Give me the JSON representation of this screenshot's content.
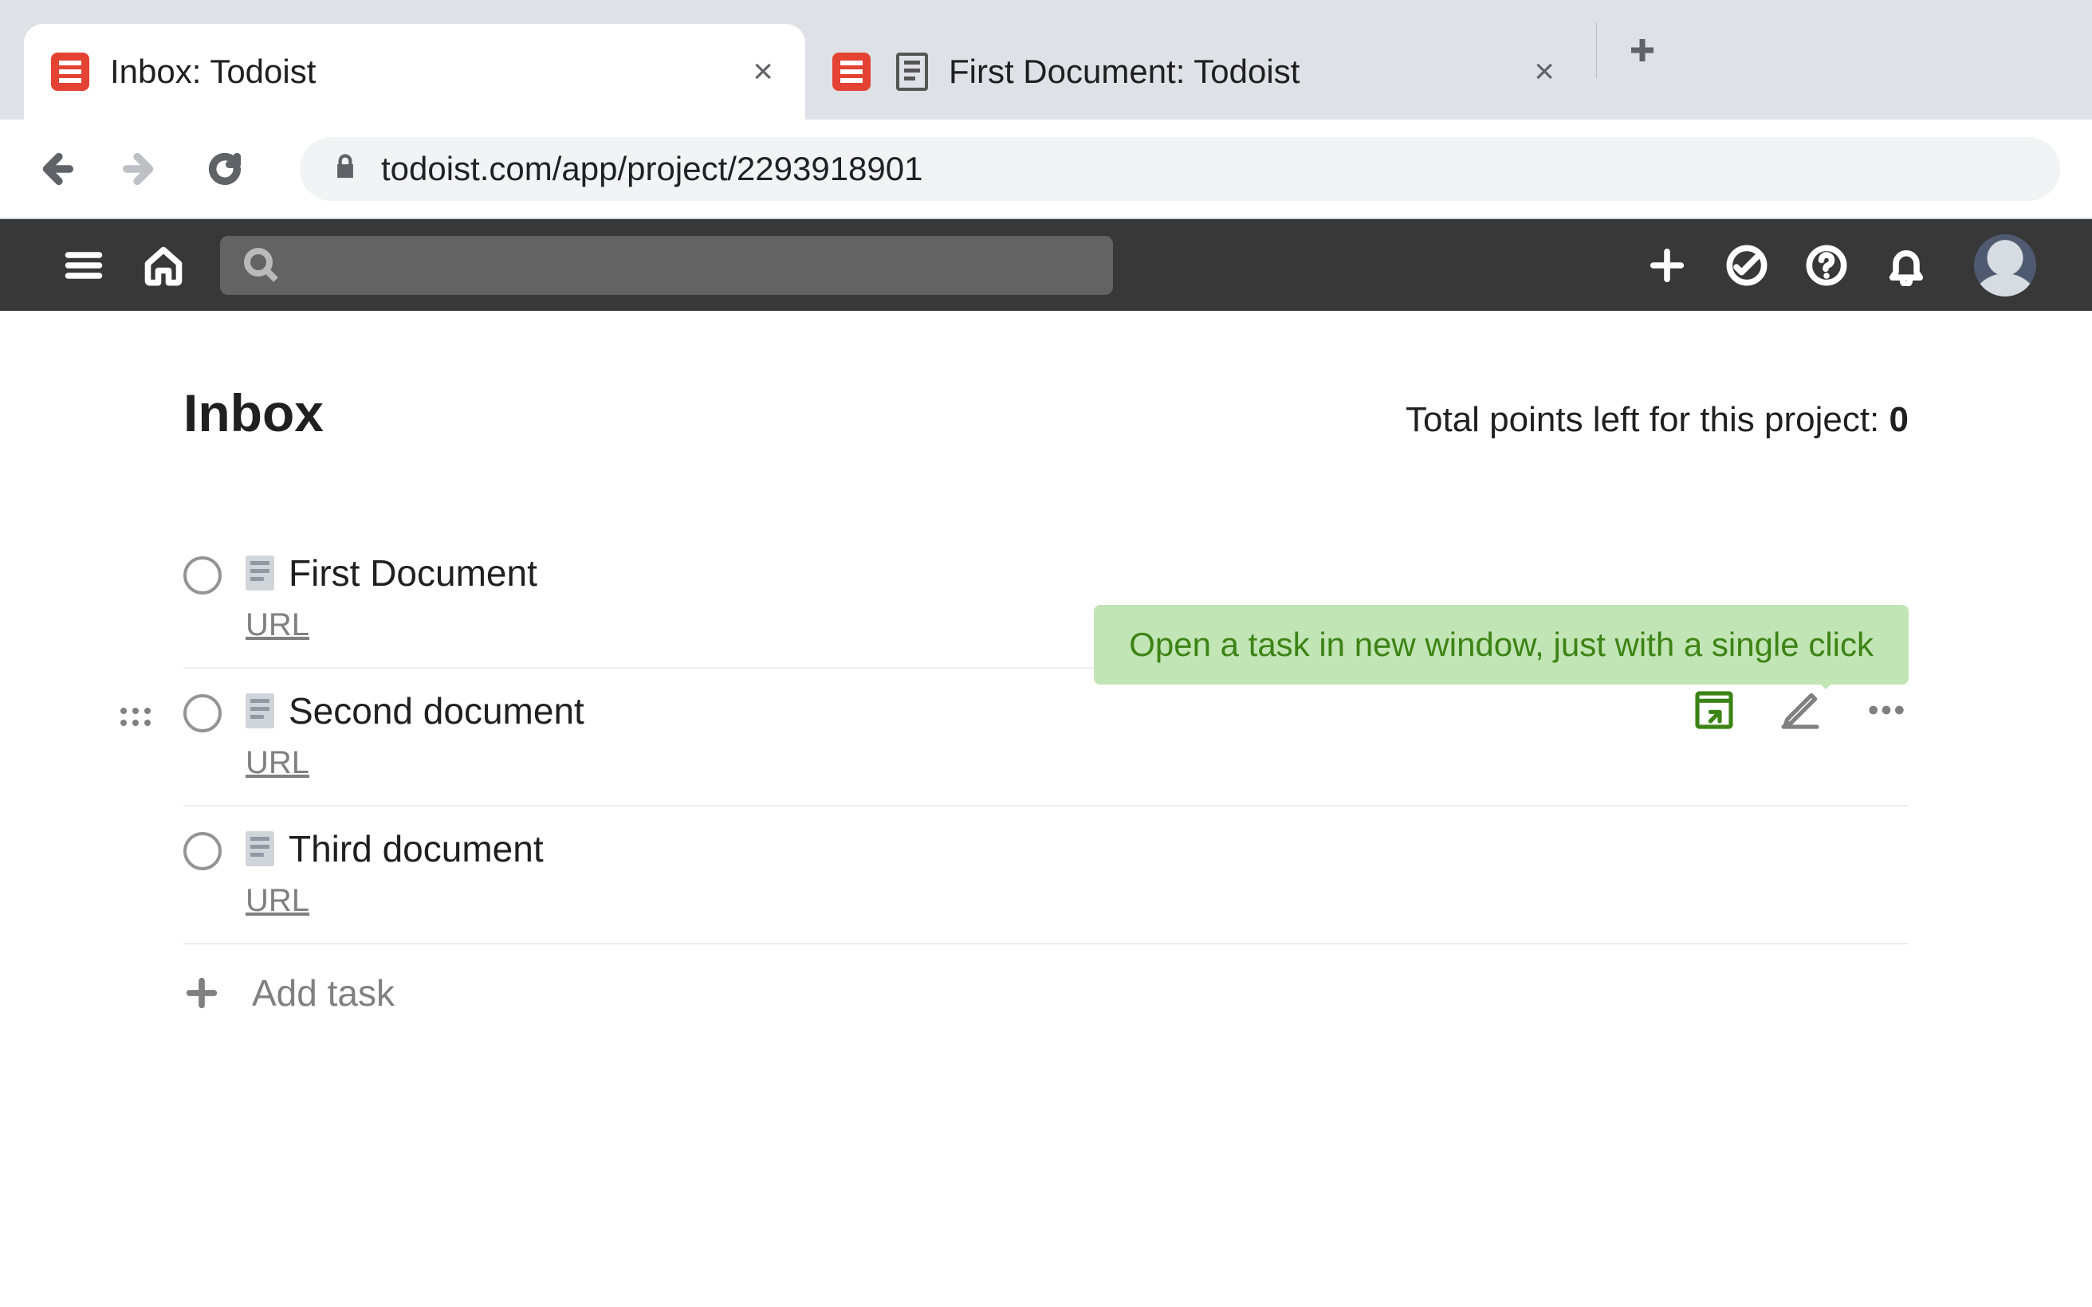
{
  "browser": {
    "tabs": [
      {
        "title": "Inbox: Todoist",
        "active": true,
        "favicon": "todoist"
      },
      {
        "title": "First Document: Todoist",
        "active": false,
        "favicon": "todoist-doc"
      }
    ],
    "url": "todoist.com/app/project/2293918901"
  },
  "header": {
    "search_placeholder": ""
  },
  "page": {
    "title": "Inbox",
    "points_label": "Total points left for this project: ",
    "points_value": "0"
  },
  "tooltip": {
    "text": "Open a task in new window, just with a single click"
  },
  "tasks": [
    {
      "title": "First Document",
      "meta": "URL",
      "hover": false
    },
    {
      "title": "Second document",
      "meta": "URL",
      "hover": true
    },
    {
      "title": "Third document",
      "meta": "URL",
      "hover": false
    }
  ],
  "add_task_label": "Add task"
}
